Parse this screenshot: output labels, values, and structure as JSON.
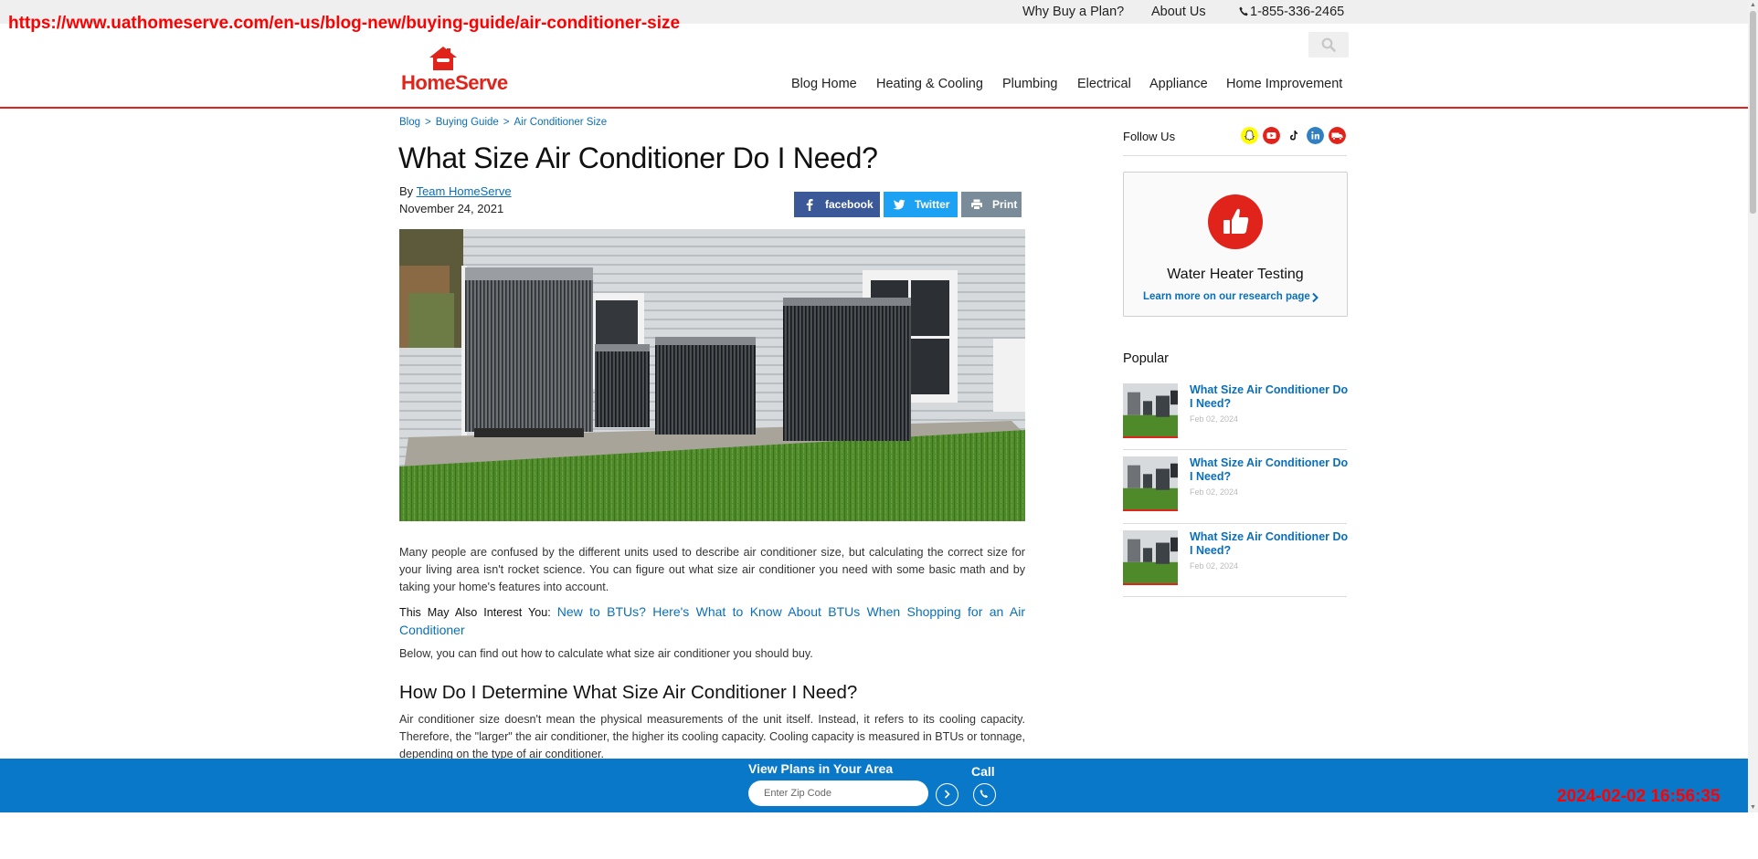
{
  "url_overlay": "https://www.uathomeserve.com/en-us/blog-new/buying-guide/air-conditioner-size",
  "timestamp_overlay": "2024-02-02 16:56:35",
  "colors": {
    "brand_red": "#e0231b",
    "link_blue": "#0a6fb9",
    "sticky_blue": "#0a78c9",
    "facebook": "#3b5998",
    "twitter": "#1da1f2",
    "print": "#7a8c9a"
  },
  "utility_bar": {
    "why_buy": "Why Buy a Plan?",
    "about": "About Us",
    "phone": "1-855-336-2465"
  },
  "header": {
    "logo_text": "HomeServe",
    "nav": [
      "Blog Home",
      "Heating & Cooling",
      "Plumbing",
      "Electrical",
      "Appliance",
      "Home Improvement"
    ]
  },
  "breadcrumb": [
    "Blog",
    "Buying Guide",
    "Air Conditioner Size"
  ],
  "breadcrumb_separator": ">",
  "article": {
    "title": "What Size Air Conditioner Do I Need?",
    "by_prefix": "By",
    "author": "Team HomeServe",
    "date": "November 24, 2021",
    "share": {
      "facebook": "facebook",
      "twitter": "Twitter",
      "print": "Print"
    },
    "intro": "Many people are confused by the different units used to describe air conditioner size, but calculating the correct size for your living area isn't rocket science. You can figure out what size air conditioner you need with some basic math and by taking your home's features into account.",
    "interest_lead": "This May Also Interest You:",
    "interest_link": "New to BTUs? Here's What to Know About BTUs When Shopping for an Air Conditioner",
    "below": "Below, you can find out how to calculate what size air conditioner you should buy.",
    "h2": "How Do I Determine What Size Air Conditioner I Need?",
    "body1": "Air conditioner size doesn't mean the physical measurements of the unit itself. Instead, it refers to its cooling capacity. Therefore, the \"larger\" the air conditioner, the higher its cooling capacity. Cooling capacity is measured in BTUs or tonnage, depending on the type of air conditioner."
  },
  "sidebar": {
    "follow_label": "Follow Us",
    "social_icons": [
      "snapchat-icon",
      "youtube-icon",
      "tiktok-icon",
      "linkedin-icon",
      "truck-icon"
    ],
    "card": {
      "title": "Water Heater Testing",
      "link": "Learn more on our research page"
    },
    "popular_label": "Popular",
    "popular": [
      {
        "title": "What Size Air Conditioner Do I Need?",
        "date": "Feb 02, 2024"
      },
      {
        "title": "What Size Air Conditioner Do I Need?",
        "date": "Feb 02, 2024"
      },
      {
        "title": "What Size Air Conditioner Do I Need?",
        "date": "Feb 02, 2024"
      }
    ]
  },
  "sticky_bar": {
    "view_plans": "View Plans in Your Area",
    "zip_placeholder": "Enter Zip Code",
    "call_label": "Call"
  }
}
